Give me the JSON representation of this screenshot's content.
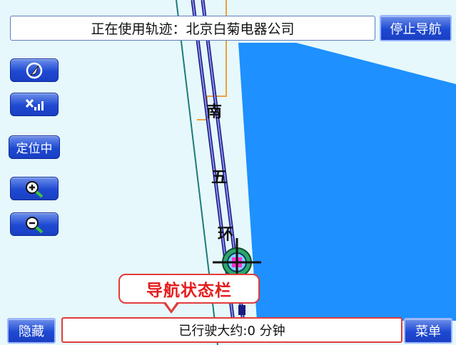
{
  "header": {
    "route_text": "正在使用轨迹：北京白菊电器公司",
    "stop_nav_label": "停止导航"
  },
  "side_buttons": {
    "compass_icon": "compass-icon",
    "gps_signal_icon": "gps-signal-icon",
    "locating_label": "定位中",
    "zoom_in_icon": "zoom-in-icon",
    "zoom_out_icon": "zoom-out-icon"
  },
  "map": {
    "road_labels": [
      "南",
      "五",
      "环"
    ],
    "colors": {
      "background": "#e6f8fb",
      "water": "#1e90ff",
      "route": "#4a4ad0",
      "minor_road": "#1f7a7a",
      "local_road": "#f0a040"
    }
  },
  "callout": {
    "label": "导航状态栏"
  },
  "footer": {
    "hide_label": "隐藏",
    "status_text": "已行驶大约:0 分钟",
    "menu_label": "菜单"
  },
  "accent_colors": {
    "button_blue": "#1e49d2",
    "status_border": "#e23c3c"
  }
}
